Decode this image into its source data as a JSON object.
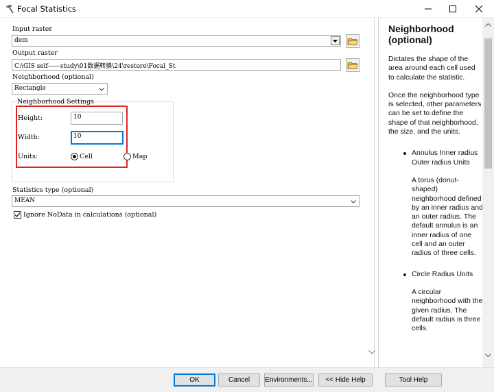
{
  "window": {
    "title": "Focal Statistics"
  },
  "form": {
    "input_raster_label": "Input raster",
    "input_raster_value": "dem",
    "output_raster_label": "Output raster",
    "output_raster_value": "C:\\GIS  self——study\\01数据转换\\24\\restore\\Focal_St",
    "neighborhood_label": "Neighborhood (optional)",
    "neighborhood_value": "Rectangle",
    "neighborhood_settings": {
      "title": "Neighborhood Settings",
      "height_label": "Height:",
      "height_value": "10",
      "width_label": "Width:",
      "width_value": "10",
      "units_label": "Units:",
      "unit_options": [
        "Cell",
        "Map"
      ],
      "selected_unit": "Cell"
    },
    "statistics_type_label": "Statistics type (optional)",
    "statistics_type_value": "MEAN",
    "ignore_nodata_label": "Ignore NoData in calculations (optional)",
    "ignore_nodata_checked": true
  },
  "help": {
    "title": "Neighborhood (optional)",
    "paragraphs": [
      "Dictates the shape of the area around each cell used to calculate the statistic.",
      "Once the neighborhood type is selected, other parameters can be set to define the shape of that neighborhood, the size, and the units."
    ],
    "items": [
      {
        "title": "Annulus Inner radius Outer radius Units",
        "desc": "A torus (donut-shaped) neighborhood defined by an inner radius and an outer radius. The default annulus is an inner radius of one cell and an outer radius of three cells."
      },
      {
        "title": "Circle Radius Units",
        "desc": "A circular neighborhood with the given radius. The default radius is three cells."
      }
    ]
  },
  "buttons": {
    "ok": "OK",
    "cancel": "Cancel",
    "environments": "Environments...",
    "hide_help": "<< Hide Help",
    "tool_help": "Tool Help"
  },
  "colors": {
    "highlight_box": "#e02424",
    "default_button_border": "#0078d7"
  }
}
